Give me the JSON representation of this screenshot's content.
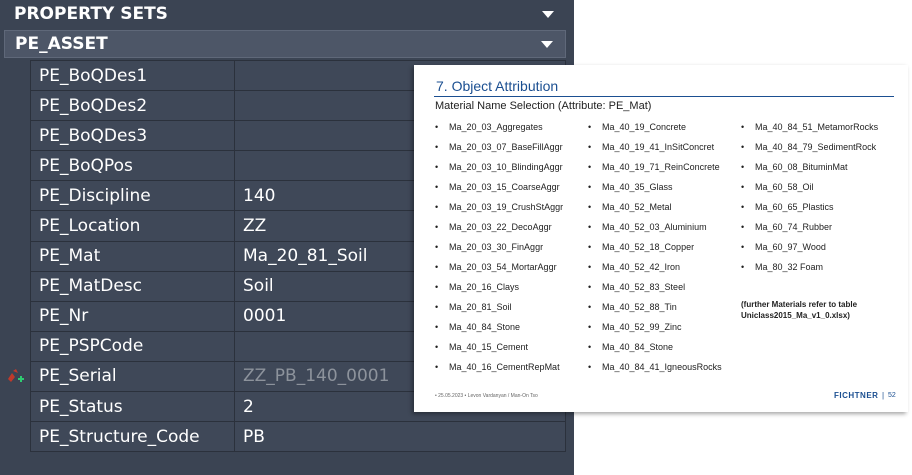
{
  "palette": {
    "header_property_sets": "PROPERTY SETS",
    "header_pe_asset": "PE_ASSET",
    "properties": [
      {
        "name": "PE_BoQDes1",
        "value": ""
      },
      {
        "name": "PE_BoQDes2",
        "value": ""
      },
      {
        "name": "PE_BoQDes3",
        "value": ""
      },
      {
        "name": "PE_BoQPos",
        "value": ""
      },
      {
        "name": "PE_Discipline",
        "value": "140"
      },
      {
        "name": "PE_Location",
        "value": "ZZ"
      },
      {
        "name": "PE_Mat",
        "value": "Ma_20_81_Soil"
      },
      {
        "name": "PE_MatDesc",
        "value": "Soil"
      },
      {
        "name": "PE_Nr",
        "value": "0001"
      },
      {
        "name": "PE_PSPCode",
        "value": ""
      },
      {
        "name": "PE_Serial",
        "value": "ZZ_PB_140_0001"
      },
      {
        "name": "PE_Status",
        "value": "2"
      },
      {
        "name": "PE_Structure_Code",
        "value": "PB"
      }
    ]
  },
  "slide": {
    "title": "7. Object Attribution",
    "subtitle": "Material Name Selection (Attribute: PE_Mat)",
    "col1": [
      "Ma_20_03_Aggregates",
      "Ma_20_03_07_BaseFillAggr",
      "Ma_20_03_10_BlindingAggr",
      "Ma_20_03_15_CoarseAggr",
      "Ma_20_03_19_CrushStAggr",
      "Ma_20_03_22_DecoAggr",
      "Ma_20_03_30_FinAggr",
      "Ma_20_03_54_MortarAggr",
      "Ma_20_16_Clays",
      "Ma_20_81_Soil",
      "Ma_40_84_Stone",
      "Ma_40_15_Cement",
      "Ma_40_16_CementRepMat"
    ],
    "col2": [
      "Ma_40_19_Concrete",
      "Ma_40_19_41_InSitConcret",
      "Ma_40_19_71_ReinConcrete",
      "Ma_40_35_Glass",
      "Ma_40_52_Metal",
      "Ma_40_52_03_Aluminium",
      "Ma_40_52_18_Copper",
      "Ma_40_52_42_Iron",
      "Ma_40_52_83_Steel",
      "Ma_40_52_88_Tin",
      "Ma_40_52_99_Zinc",
      "Ma_40_84_Stone",
      "Ma_40_84_41_IgneousRocks"
    ],
    "col3": [
      "Ma_40_84_51_MetamorRocks",
      "Ma_40_84_79_SedimentRock",
      "Ma_60_08_BituminMat",
      "Ma_60_58_Oil",
      "Ma_60_65_Plastics",
      "Ma_60_74_Rubber",
      "Ma_60_97_Wood",
      "Ma_80_32  Foam"
    ],
    "further_note": "(further Materials refer to table Uniclass2015_Ma_v1_0.xlsx)",
    "footer": "• 25.05.2023 • Levon Vardanyan / Man-On Tso",
    "brand": "FICHTNER",
    "separator": "|",
    "page_number": "52"
  },
  "colors": {
    "palette_bg": "#3b4453",
    "accent_blue": "#1b4f91"
  }
}
